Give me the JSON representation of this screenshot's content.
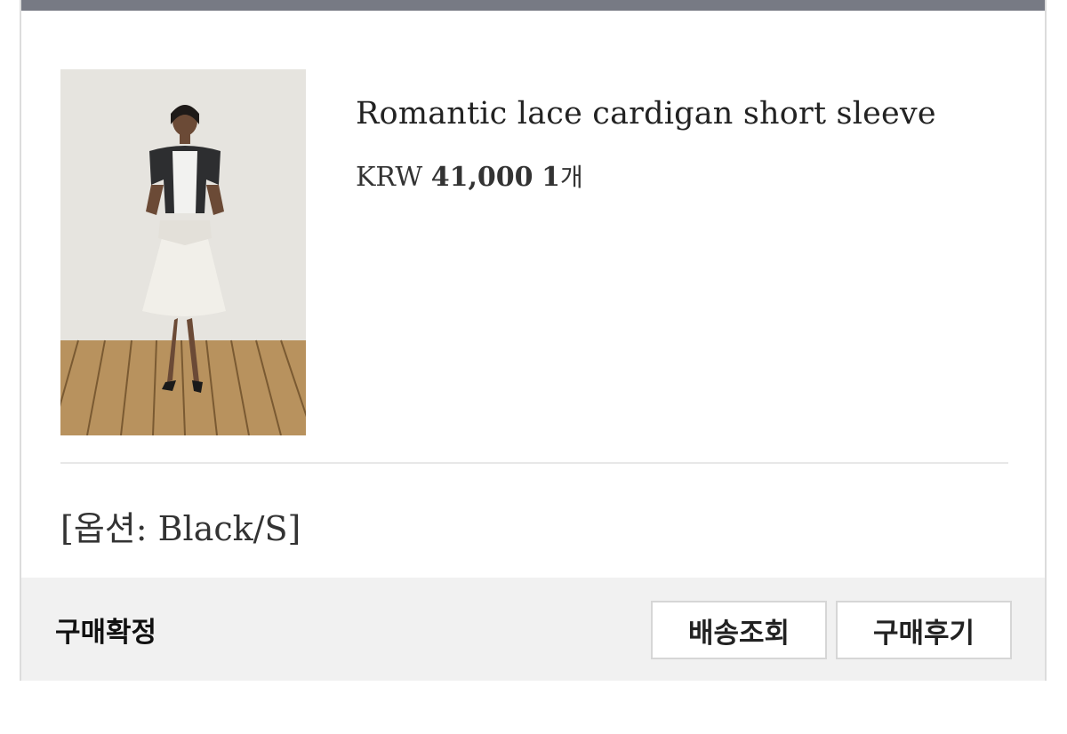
{
  "product": {
    "image_alt": "Model wearing black lace short sleeve cardigan and white skirt",
    "title": "Romantic lace cardigan short sleeve",
    "currency": "KRW",
    "price": "41,000",
    "quantity": "1",
    "quantity_unit": "개"
  },
  "option_text": "[옵션: Black/S]",
  "footer": {
    "status": "구매확정",
    "track_label": "배송조회",
    "review_label": "구매후기"
  },
  "colors": {
    "topbar": "#777a84",
    "footer_bg": "#f1f1f1",
    "border": "#dcdcdc"
  }
}
